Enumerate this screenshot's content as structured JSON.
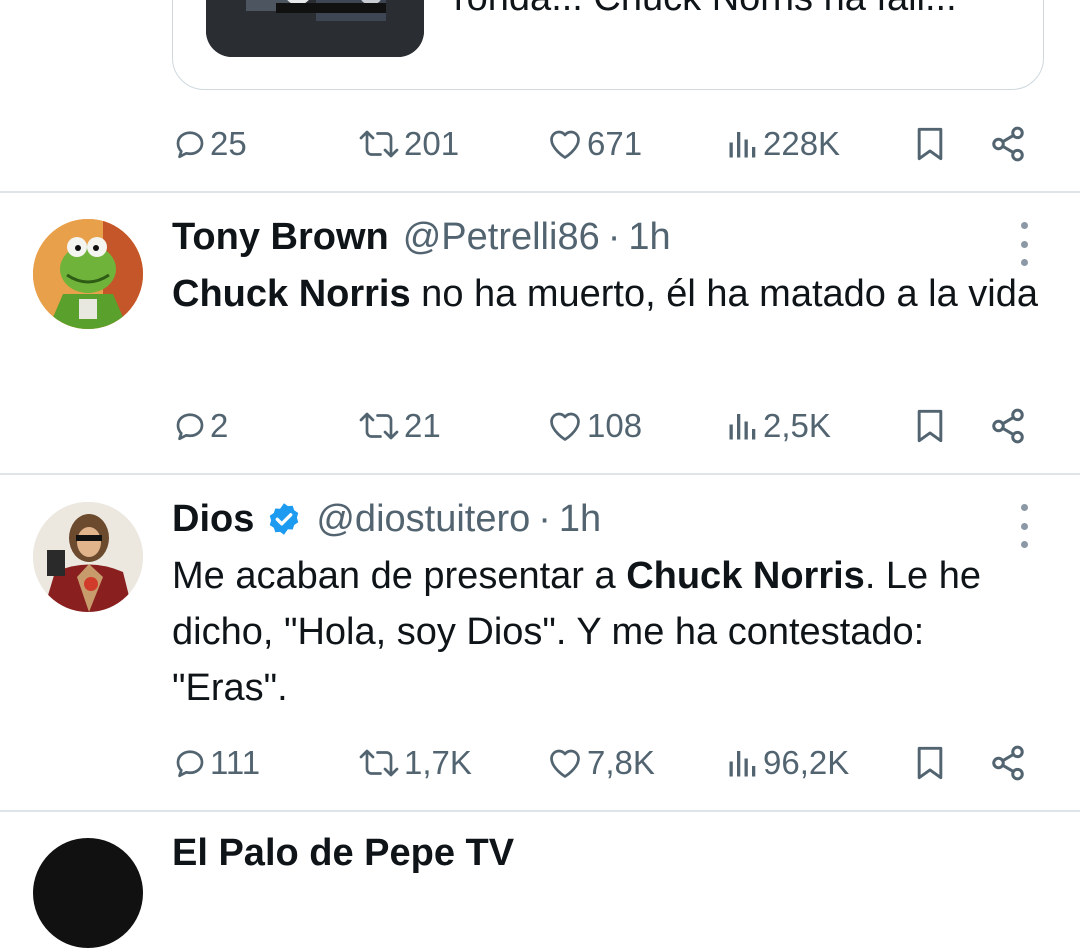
{
  "quoted": {
    "text": "ronda... Chuck Norris ha fall..."
  },
  "tweets": [
    {
      "stats": {
        "replies": "25",
        "retweets": "201",
        "likes": "671",
        "views": "228K"
      }
    },
    {
      "name": "Tony Brown",
      "handle": "@Petrelli86",
      "separator": "·",
      "time": "1h",
      "body_bold": "Chuck Norris",
      "body_rest": " no ha muerto, él ha matado a la vida",
      "stats": {
        "replies": "2",
        "retweets": "21",
        "likes": "108",
        "views": "2,5K"
      },
      "avatar": "kermit-avatar"
    },
    {
      "name": "Dios",
      "handle": "@diostuitero",
      "separator": "·",
      "time": "1h",
      "body_pre": "Me acaban de presentar a ",
      "body_bold": "Chuck Norris",
      "body_post": ". Le he dicho, \"Hola, soy Dios\". Y me ha contestado: \"Eras\".",
      "verified": true,
      "stats": {
        "replies": "111",
        "retweets": "1,7K",
        "likes": "7,8K",
        "views": "96,2K"
      },
      "avatar": "jesus-avatar"
    },
    {
      "name": "El Palo de Pepe TV"
    }
  ],
  "colors": {
    "text": "#0f1419",
    "secondary": "#536471",
    "verified": "#1d9bf0",
    "divider": "#dfe4e8"
  }
}
